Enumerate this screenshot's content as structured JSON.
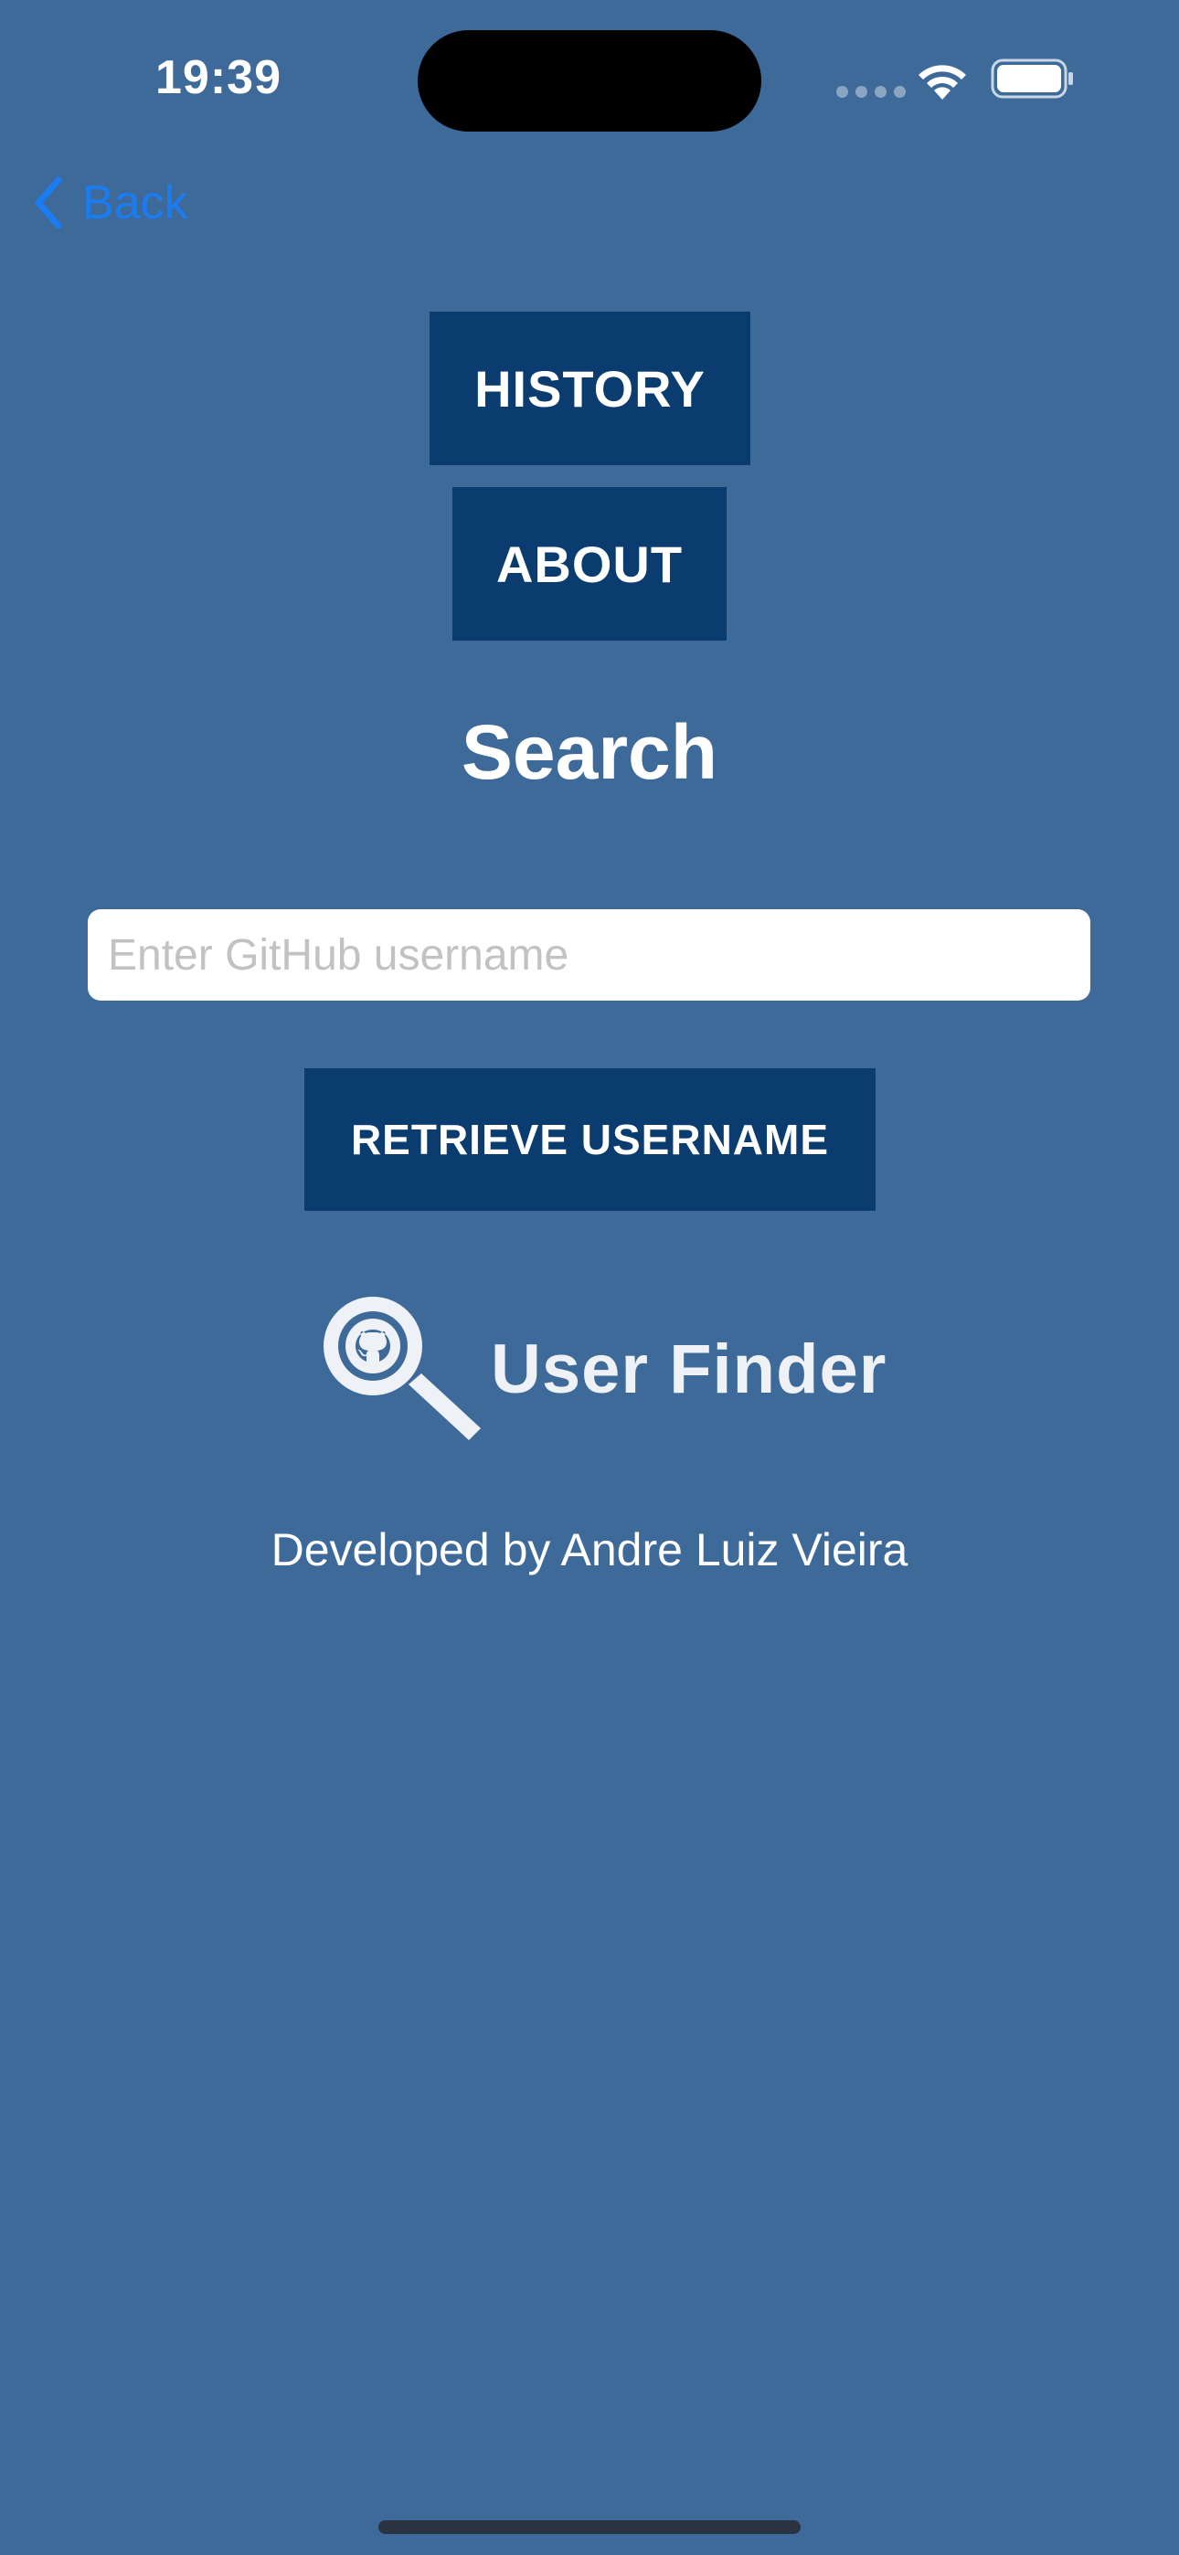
{
  "status_bar": {
    "time": "19:39"
  },
  "nav": {
    "back_label": "Back"
  },
  "buttons": {
    "history_label": "HISTORY",
    "about_label": "ABOUT",
    "retrieve_label": "RETRIEVE USERNAME"
  },
  "search": {
    "title": "Search",
    "placeholder": "Enter GitHub username",
    "value": ""
  },
  "logo": {
    "text": "User Finder",
    "icon": "github-magnifier-icon"
  },
  "footer": {
    "developed_by": "Developed by Andre Luiz Vieira"
  },
  "colors": {
    "background": "#3e6a9a",
    "button": "#0a3c70",
    "back_link": "#1a7cf0",
    "text": "#ffffff"
  }
}
